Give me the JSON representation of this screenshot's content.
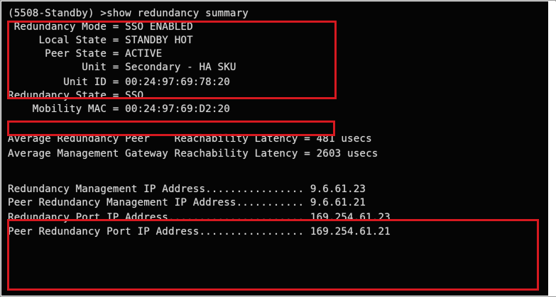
{
  "terminal": {
    "prompt_line": "(5508-Standby) >show redundancy summary",
    "summary": [
      {
        "label": " Redundancy Mode",
        "value": "SSO ENABLED"
      },
      {
        "label": "     Local State",
        "value": "STANDBY HOT"
      },
      {
        "label": "      Peer State",
        "value": "ACTIVE"
      },
      {
        "label": "            Unit",
        "value": "Secondary - HA SKU"
      },
      {
        "label": "         Unit ID",
        "value": "00:24:97:69:78:20"
      },
      {
        "label": "Redundancy State",
        "value": "SSO"
      },
      {
        "label": "    Mobility MAC",
        "value": "00:24:97:69:D2:20"
      }
    ],
    "latency_lines": [
      "Average Redundancy Peer    Reachability Latency = 481 usecs",
      "Average Management Gateway Reachability Latency = 2603 usecs"
    ],
    "address_lines": [
      "Redundancy Management IP Address................ 9.6.61.23",
      "Peer Redundancy Management IP Address........... 9.6.61.21",
      "Redundancy Port IP Address...................... 169.254.61.23",
      "Peer Redundancy Port IP Address................. 169.254.61.21"
    ]
  },
  "colors": {
    "terminal_background": "#050505",
    "terminal_text": "#d8d8d8",
    "highlight": "#d71920"
  }
}
